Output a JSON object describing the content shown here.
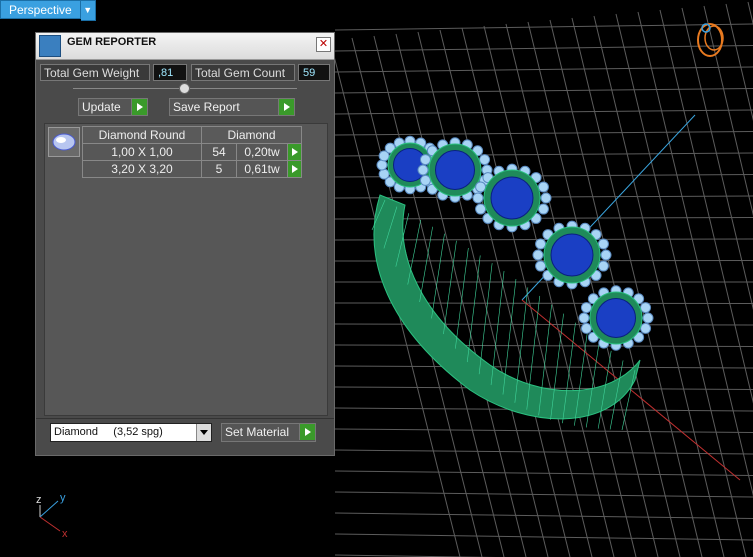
{
  "viewport": {
    "mode_label": "Perspective",
    "axis_labels": {
      "x": "x",
      "y": "y",
      "z": "z"
    }
  },
  "panel": {
    "title": "GEM REPORTER",
    "close_glyph": "✕",
    "total_weight_label": "Total Gem Weight",
    "total_weight_value": ",81",
    "total_count_label": "Total Gem Count",
    "total_count_value": "59",
    "update_label": "Update",
    "save_report_label": "Save Report",
    "table": {
      "headers": [
        "Diamond Round",
        "Diamond"
      ],
      "rows": [
        {
          "size": "1,00 X 1,00",
          "count": "54",
          "weight": "0,20tw"
        },
        {
          "size": "3,20 X 3,20",
          "count": "5",
          "weight": "0,61tw"
        }
      ]
    },
    "material_select": "Diamond     (3,52 spg)",
    "set_material_label": "Set Material"
  },
  "colors": {
    "ring_green": "#1f8a5a",
    "stone_blue": "#1a3fc4",
    "accent_stone": "#a8d4f5",
    "grid": "#606060",
    "persp_bg": "#3aa0e0"
  }
}
